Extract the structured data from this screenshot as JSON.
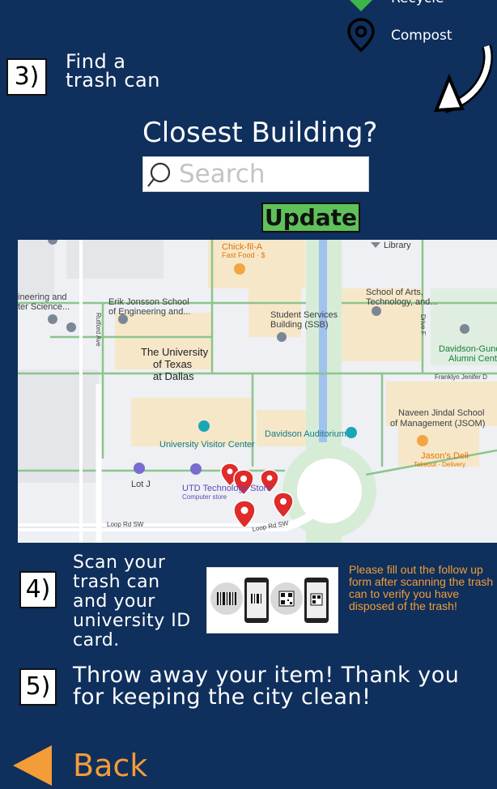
{
  "legend": {
    "recycle_label": "Recycle",
    "compost_label": "Compost",
    "recycle_color": "#3cb54a"
  },
  "step3": {
    "number": "3)",
    "line1": "Find a",
    "line2": "trash can"
  },
  "closest_building": {
    "title": "Closest Building?",
    "search_placeholder": "Search",
    "update_label": "Update"
  },
  "map": {
    "labels": {
      "chick_fil_a": "Chick-fil-A",
      "chick_fil_a_sub": "Fast Food · $",
      "library": "Library",
      "school_arts_1": "School of Arts,",
      "school_arts_2": "Technology, and...",
      "eng_left_1": "ineering and",
      "eng_left_2": "ter Science...",
      "jonsson_1": "Erik Jonsson School",
      "jonsson_2": "of Engineering and...",
      "ssb_1": "Student Services",
      "ssb_2": "Building (SSB)",
      "rutford": "Rutford Ave",
      "drive_f": "Drive F",
      "utd_1": "The University",
      "utd_2": "of Texas",
      "utd_3": "at Dallas",
      "davidson_gundy_1": "Davidson-Gundy",
      "davidson_gundy_2": "Alumni Center",
      "franklyn": "Franklyn Jenifer D",
      "jindal_1": "Naveen Jindal School",
      "jindal_2": "of Management (JSOM)",
      "visitor_center": "University Visitor Center",
      "davidson_aud": "Davidson Auditorium",
      "jasons_1": "Jason's Deli",
      "jasons_2": "Takeout · Delivery",
      "lot_j": "Lot J",
      "tech_store_1": "UTD Technology Store",
      "tech_store_2": "Computer store",
      "loop_rd_1": "Loop Rd SW",
      "loop_rd_2": "Loop Rd SW"
    }
  },
  "step4": {
    "number": "4)",
    "lines": [
      "Scan your",
      "trash can",
      "and your",
      "university ID",
      "card."
    ],
    "note": "Please fill out the follow up form after scanning the trash can to verify you have disposed of the trash!"
  },
  "step5": {
    "number": "5)",
    "line1": "Throw away your item! Thank you",
    "line2": "for keeping the city clean!"
  },
  "back": {
    "label": "Back",
    "arrow_color": "#f29d38"
  }
}
